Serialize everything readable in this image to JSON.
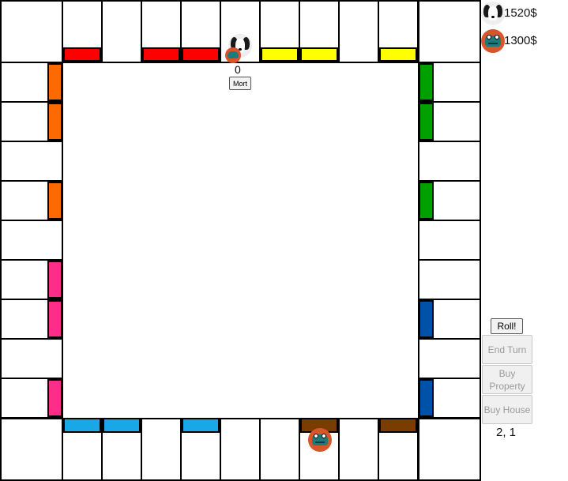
{
  "players": [
    {
      "icon": "dog-token-icon",
      "money": "1520$"
    },
    {
      "icon": "frog-token-icon",
      "money": "1300$"
    }
  ],
  "controls": {
    "roll": "Roll!",
    "end_turn": "End Turn",
    "buy_property": "Buy Property",
    "buy_house": "Buy House"
  },
  "dice": "2, 1",
  "selected_property": {
    "houses": "0",
    "mortgage_label": "Mort"
  },
  "colors": {
    "red": "#ff0000",
    "yellow": "#ffff00",
    "green": "#00a000",
    "orange": "#ff6a00",
    "pink": "#ff2d8a",
    "dark_blue": "#0051a8",
    "light_blue": "#1aa7e8",
    "brown": "#7a3c00"
  }
}
